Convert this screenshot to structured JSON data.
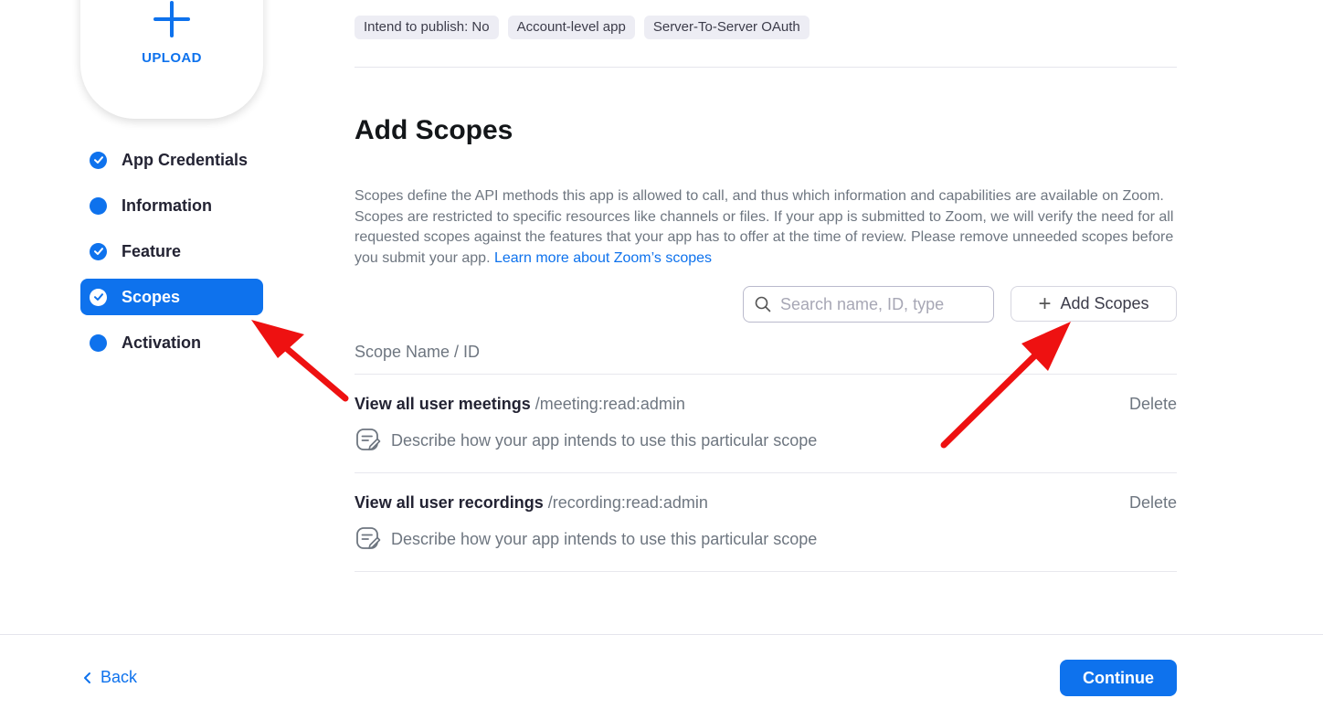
{
  "upload": {
    "label": "UPLOAD"
  },
  "nav": {
    "items": [
      {
        "label": "App Credentials",
        "icon": "check-circle-icon"
      },
      {
        "label": "Information",
        "icon": "dot-icon"
      },
      {
        "label": "Feature",
        "icon": "check-circle-icon"
      },
      {
        "label": "Scopes",
        "icon": "check-circle-icon",
        "active": true
      },
      {
        "label": "Activation",
        "icon": "dot-icon"
      }
    ]
  },
  "tags": [
    "Intend to publish: No",
    "Account-level app",
    "Server-To-Server OAuth"
  ],
  "main": {
    "title": "Add Scopes",
    "description": "Scopes define the API methods this app is allowed to call, and thus which information and capabilities are available on Zoom. Scopes are restricted to specific resources like channels or files. If your app is submitted to Zoom, we will verify the need for all requested scopes against the features that your app has to offer at the time of review. Please remove unneeded scopes before you submit your app.",
    "learn_more": "Learn more about Zoom’s scopes",
    "search_placeholder": "Search name, ID, type",
    "add_scopes_label": "Add Scopes",
    "column_header": "Scope Name / ID"
  },
  "scopes": [
    {
      "name": "View all user meetings",
      "id": "/meeting:read:admin",
      "delete": "Delete",
      "note": "Describe how your app intends to use this particular scope"
    },
    {
      "name": "View all user recordings",
      "id": "/recording:read:admin",
      "delete": "Delete",
      "note": "Describe how your app intends to use this particular scope"
    }
  ],
  "footer": {
    "back": "Back",
    "continue": "Continue"
  },
  "colors": {
    "accent": "#0e72ed",
    "annotation_arrow": "#ee1111"
  }
}
